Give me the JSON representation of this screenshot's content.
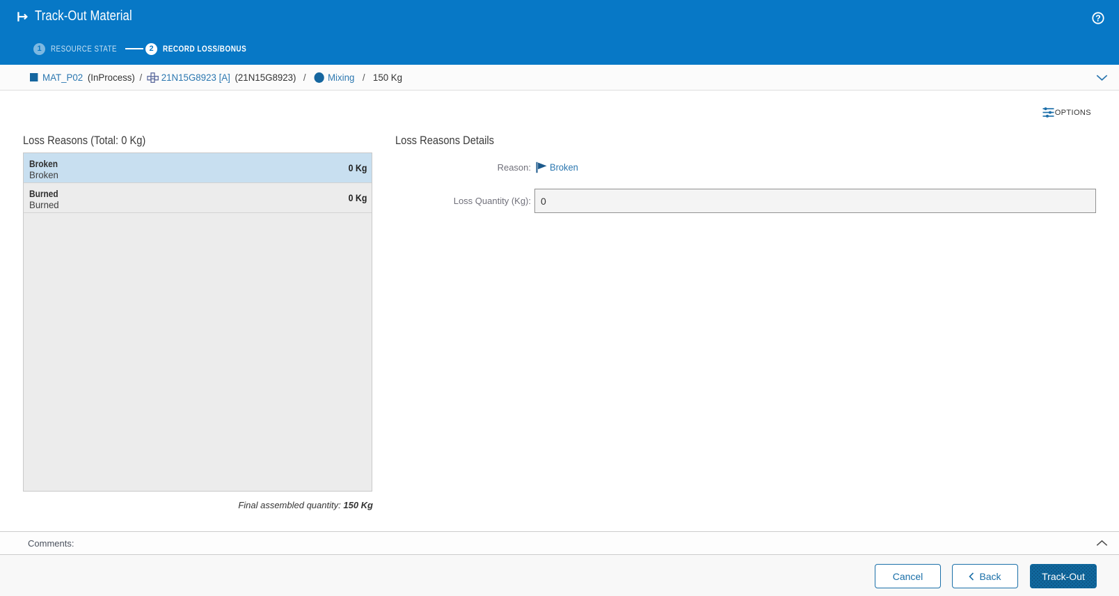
{
  "header": {
    "title": "Track-Out Material",
    "steps": [
      {
        "number": "1",
        "label": "RESOURCE STATE",
        "state": "done"
      },
      {
        "number": "2",
        "label": "RECORD LOSS/BONUS",
        "state": "active"
      }
    ]
  },
  "breadcrumb": {
    "material_name": "MAT_P02",
    "material_state": "(InProcess)",
    "sep1": "/",
    "product": "21N15G8923 [A]",
    "product_alt": "(21N15G8923)",
    "sep2": "/",
    "step_name": "Mixing",
    "sep3": "/",
    "quantity": "150 Kg"
  },
  "toolbar": {
    "options_label": "OPTIONS"
  },
  "loss_reasons": {
    "heading": "Loss Reasons (Total: 0 Kg)",
    "items": [
      {
        "title": "Broken",
        "subtitle": "Broken",
        "quantity": "0 Kg"
      },
      {
        "title": "Burned",
        "subtitle": "Burned",
        "quantity": "0 Kg"
      }
    ],
    "final_quantity_label": "Final assembled quantity:",
    "final_quantity_value": "150 Kg"
  },
  "details": {
    "heading": "Loss Reasons Details",
    "reason_label": "Reason:",
    "reason_value": "Broken",
    "loss_quantity_label": "Loss Quantity (Kg):",
    "loss_quantity_value": "0"
  },
  "comments": {
    "label": "Comments:"
  },
  "footer": {
    "cancel_label": "Cancel",
    "back_label": "Back",
    "trackout_label": "Track-Out"
  },
  "colors": {
    "header_blue": "#0778c6",
    "link_blue": "#2b77b0",
    "entity_blue": "#15669f",
    "primary_button_blue": "#116ba6",
    "selected_row_blue": "#c8dff0",
    "panel_gray": "#ececec"
  }
}
